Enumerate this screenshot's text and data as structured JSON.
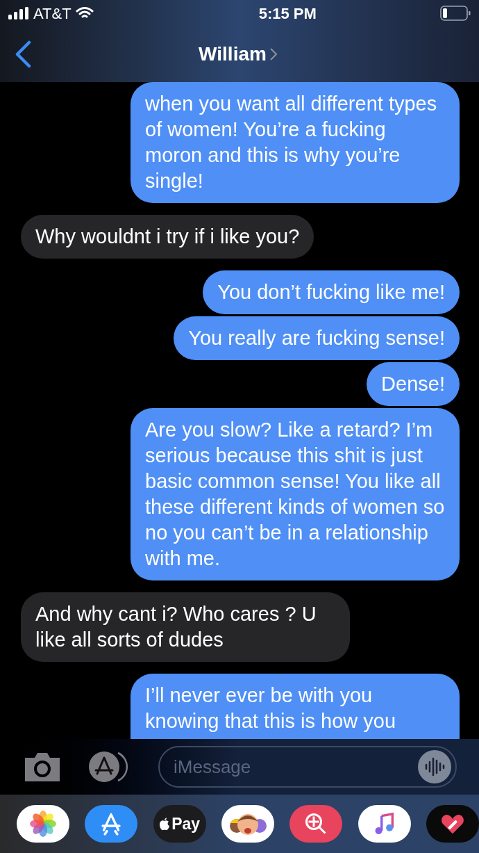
{
  "status_bar": {
    "carrier": "AT&T",
    "time": "5:15 PM"
  },
  "header": {
    "contact": "William"
  },
  "messages": [
    {
      "kind": "sent",
      "text": "when you want all different types of women! You’re a fucking moron and this is why you’re single!"
    },
    {
      "kind": "received",
      "text": "Why wouldnt i try if i like you?"
    },
    {
      "kind": "sent",
      "text": "You don’t fucking like me!"
    },
    {
      "kind": "sent",
      "text": "You really are fucking sense!"
    },
    {
      "kind": "sent",
      "text": "Dense!"
    },
    {
      "kind": "sent",
      "text": "Are you slow? Like a retard? I’m serious because this shit is just basic common sense! You like all these different kinds of women so no you can’t be in a relationship with me."
    },
    {
      "kind": "received",
      "text": "And why cant i? Who cares ? U like all sorts of dudes"
    },
    {
      "kind": "sent",
      "text": "I’ll never ever be with you knowing that this is how you"
    }
  ],
  "composer": {
    "placeholder": "iMessage"
  },
  "app_drawer": [
    {
      "kind": "photos"
    },
    {
      "kind": "appstore"
    },
    {
      "kind": "pay",
      "label": "Pay"
    },
    {
      "kind": "memoji"
    },
    {
      "kind": "search"
    },
    {
      "kind": "music"
    },
    {
      "kind": "heart"
    }
  ]
}
